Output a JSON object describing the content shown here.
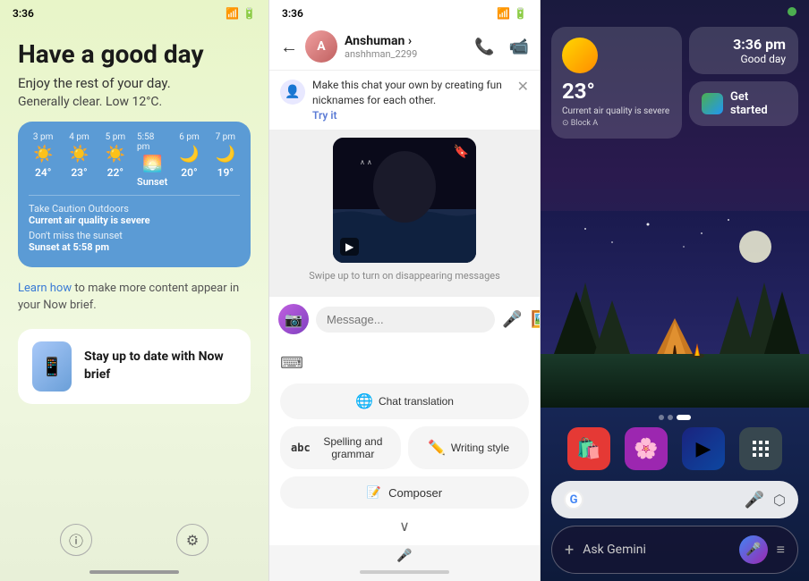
{
  "panel1": {
    "status_time": "3:36",
    "greeting": "Have a good day",
    "subtitle": "Enjoy the rest of your day.",
    "weather_text": "Generally clear. Low 12°C.",
    "weather_times": [
      "3 pm",
      "4 pm",
      "5 pm",
      "5:58 pm",
      "6 pm",
      "7 pm"
    ],
    "weather_icons": [
      "☀️",
      "☀️",
      "☀️",
      "🌅",
      "🌙",
      "🌙"
    ],
    "weather_temps": [
      "24°",
      "23°",
      "22°",
      "Sunset",
      "20°",
      "19°"
    ],
    "alert_label": "Take Caution Outdoors",
    "alert_value": "Current air quality is severe",
    "sunset_label": "Don't miss the sunset",
    "sunset_value": "Sunset at 5:58 pm",
    "learn_text": "Learn how to make more content appear in your Now brief.",
    "learn_link": "Learn how",
    "now_title": "Stay up to date with Now brief"
  },
  "panel2": {
    "status_time": "3:36",
    "contact_name": "Anshuman",
    "contact_arrow": "›",
    "contact_username": "anshhman_2299",
    "banner_text": "Make this chat your own by creating fun nicknames for each other.",
    "banner_link": "Try it",
    "disappear_hint": "Swipe up to turn on disappearing messages",
    "input_placeholder": "Message...",
    "suggestions": [
      {
        "icon": "🌐",
        "label": "Chat translation"
      },
      {
        "icon": "abc",
        "label": "Spelling and grammar"
      },
      {
        "icon": "✏️",
        "label": "Writing style"
      }
    ],
    "composer_label": "Composer",
    "chevron": "∨"
  },
  "panel3": {
    "time": "3:36 pm",
    "greeting": "Good day",
    "weather_temp": "23°",
    "weather_desc": "Current air quality is severe",
    "weather_location": "⊙ Block A",
    "gemini_label": "Get started",
    "search_placeholder": "Ask Gemini",
    "dots": [
      false,
      false,
      true
    ],
    "apps": [
      "🛍️",
      "🌸",
      "▶️",
      "⊞"
    ]
  }
}
